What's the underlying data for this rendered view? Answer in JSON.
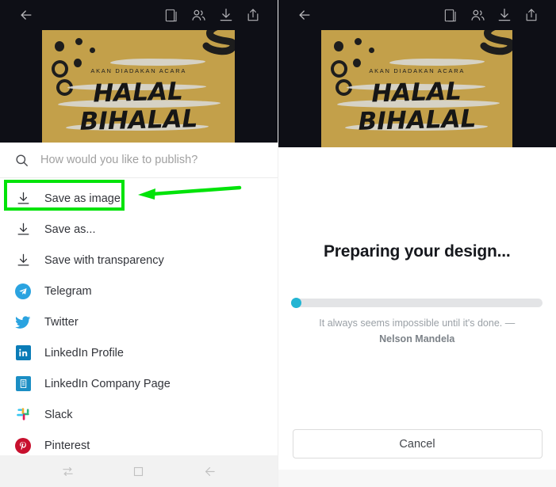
{
  "toolbar": {
    "back_icon": "back-arrow-icon",
    "icons": [
      {
        "name": "duplicate-pages-icon",
        "label": "Pages"
      },
      {
        "name": "collaborators-icon",
        "label": "Collaborate"
      },
      {
        "name": "download-icon",
        "label": "Download"
      },
      {
        "name": "share-icon",
        "label": "Share"
      }
    ]
  },
  "design": {
    "kicker": "AKAN DIADAKAN ACARA",
    "title_line1": "HALAL",
    "title_line2": "BIHALAL",
    "background_color": "#c3a04a",
    "ink_color": "#1d1d1d",
    "brush_color": "#d8d6cf"
  },
  "search": {
    "placeholder": "How would you like to publish?",
    "value": "",
    "icon": "search-icon"
  },
  "menu": {
    "items": [
      {
        "label": "Save as image",
        "icon": "download-icon",
        "highlighted": true
      },
      {
        "label": "Save as...",
        "icon": "download-icon",
        "highlighted": false
      },
      {
        "label": "Save with transparency",
        "icon": "download-icon",
        "highlighted": false
      },
      {
        "label": "Telegram",
        "icon": "telegram-icon",
        "highlighted": false
      },
      {
        "label": "Twitter",
        "icon": "twitter-icon",
        "highlighted": false
      },
      {
        "label": "LinkedIn Profile",
        "icon": "linkedin-icon",
        "highlighted": false
      },
      {
        "label": "LinkedIn Company Page",
        "icon": "linkedin-company-icon",
        "highlighted": false
      },
      {
        "label": "Slack",
        "icon": "slack-icon",
        "highlighted": false
      },
      {
        "label": "Pinterest",
        "icon": "pinterest-icon",
        "highlighted": false
      }
    ]
  },
  "annotation": {
    "highlight_color": "#00e309",
    "target_label": "Save as image"
  },
  "navbar": {
    "items": [
      {
        "name": "recents-button",
        "icon": "recents-icon"
      },
      {
        "name": "home-button",
        "icon": "home-square-icon"
      },
      {
        "name": "back-button",
        "icon": "back-arrow-icon"
      }
    ]
  },
  "dialog": {
    "title": "Preparing your design...",
    "progress_percent": 2,
    "progress_color": "#23b5d3",
    "quote": "It always seems impossible until it's done. —",
    "quote_author": "Nelson Mandela",
    "cancel_label": "Cancel"
  },
  "colors": {
    "toolbar_bg": "#0e0f16",
    "sheet_bg": "#ffffff",
    "text_primary": "#32343a",
    "text_muted": "#9aa0a6"
  }
}
